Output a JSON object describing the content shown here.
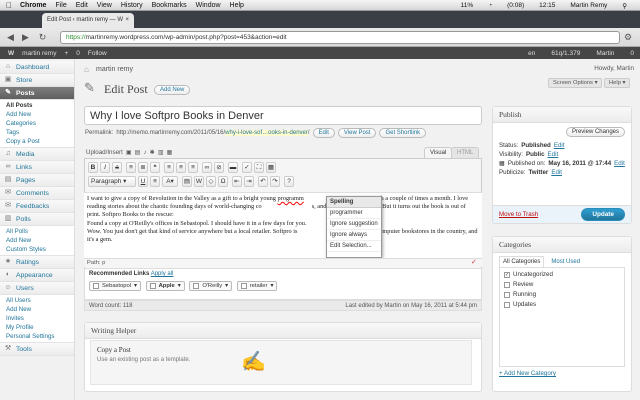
{
  "mac_menu": {
    "apple": "",
    "app": "Chrome",
    "items": [
      "File",
      "Edit",
      "View",
      "History",
      "Bookmarks",
      "Window",
      "Help"
    ],
    "battery": "11%",
    "time_a": "(0:08)",
    "time_b": "12:15",
    "user": "Martin Remy"
  },
  "browser": {
    "tab_title": "Edit Post ‹ martin remy — W",
    "tab_close": "×",
    "url_scheme": "https://",
    "url_rest": "martinremy.wordpress.com/wp-admin/post.php?post=453&action=edit",
    "back": "◀",
    "forward": "▶",
    "reload": "↻"
  },
  "wpbar": {
    "logo": "W",
    "site": "martin remy",
    "new": "+",
    "comments": "0",
    "follow": "Follow",
    "lang": "en",
    "stats": "61q/1.379",
    "user": "Martin",
    "notif": "0"
  },
  "sidebar": {
    "items": [
      {
        "label": "Dashboard",
        "icon": "⌂"
      },
      {
        "label": "Store",
        "icon": "▣"
      },
      {
        "label": "Posts",
        "icon": "✎"
      }
    ],
    "posts_sub": [
      "All Posts",
      "Add New",
      "Categories",
      "Tags",
      "Copy a Post"
    ],
    "items2": [
      {
        "label": "Media",
        "icon": "♫"
      },
      {
        "label": "Links",
        "icon": "∞"
      },
      {
        "label": "Pages",
        "icon": "▤"
      },
      {
        "label": "Comments",
        "icon": "✉"
      },
      {
        "label": "Feedbacks",
        "icon": "✉"
      },
      {
        "label": "Polls",
        "icon": "▥"
      }
    ],
    "polls_sub": [
      "All Polls",
      "Add New",
      "Custom Styles"
    ],
    "items3": [
      {
        "label": "Ratings",
        "icon": "★"
      },
      {
        "label": "Appearance",
        "icon": "◐"
      },
      {
        "label": "Users",
        "icon": "☺"
      }
    ],
    "users_sub": [
      "All Users",
      "Add New",
      "Invites",
      "My Profile",
      "Personal Settings"
    ],
    "items4": [
      {
        "label": "Tools",
        "icon": "⚒"
      }
    ]
  },
  "header": {
    "site_name": "martin remy",
    "howdy": "Howdy, Martin",
    "screen_options": "Screen Options ▾",
    "help": "Help ▾",
    "page_title": "Edit Post",
    "add_new": "Add New"
  },
  "post": {
    "title": "Why I love Softpro Books in Denver",
    "permalink_label": "Permalink:",
    "permalink_base": "http://memo.martinremy.com/2011/05/16/",
    "permalink_slug": "why-i-love-sof…ooks-in-denver",
    "permalink_end": "/",
    "edit_btn": "Edit",
    "view_btn": "View Post",
    "shortlink_btn": "Get Shortlink",
    "upload_insert": "Upload/Insert",
    "tab_visual": "Visual",
    "tab_html": "HTML",
    "paragraph_select": "Paragraph",
    "body_1": "I want to give a copy of Revolution in the Valley as a gift to a bright young ",
    "body_misspelled": "programm",
    "body_1b": "I met with a couple of times a month.  I love reading stories about the chaotic founding days of world-changing co",
    "body_1c": "s, and I think he would too.  But it turns out the book is out of print.  Softpro Books to the rescue:",
    "body_2": "Found a copy at O'Reilly's offices in Sebastopol. I should have it in a few days for you.",
    "body_3": "Wow.  You just don't get that kind of service anywhere but a local retailer.  Softpro is",
    "body_3b": "ining retail computer bookstores in the country, and it's a gem.",
    "path": "Path: p",
    "rec_title": "Recommended Links",
    "apply_all": "Apply all",
    "rec_tags": [
      "Sebastopol",
      "Apple",
      "O'Reilly",
      "retailer"
    ],
    "word_count": "Word count: 118",
    "last_edited": "Last edited by Martin on May 16, 2011 at 5:44 pm"
  },
  "spell_menu": {
    "title": "Spelling",
    "items": [
      "programmer",
      "Ignore suggestion",
      "Ignore always",
      "Edit Selection..."
    ]
  },
  "writing_helper": {
    "title": "Writing Helper",
    "copy_title": "Copy a Post",
    "copy_desc": "Use an existing post as a template."
  },
  "publish": {
    "title": "Publish",
    "preview": "Preview Changes",
    "status_label": "Status:",
    "status_value": "Published",
    "visibility_label": "Visibility:",
    "visibility_value": "Public",
    "published_label": "Published on:",
    "published_value": "May 16, 2011 @ 17:44",
    "publicize_label": "Publicize:",
    "publicize_value": "Twitter",
    "edit": "Edit",
    "trash": "Move to Trash",
    "update": "Update"
  },
  "categories": {
    "title": "Categories",
    "tab_all": "All Categories",
    "tab_most": "Most Used",
    "items": [
      {
        "label": "Uncategorized",
        "checked": true
      },
      {
        "label": "Review",
        "checked": false
      },
      {
        "label": "Running",
        "checked": false
      },
      {
        "label": "Updates",
        "checked": false
      }
    ],
    "add_new": "+ Add New Category"
  },
  "colors": {
    "link": "#21759b",
    "current_menu": "#6d6d6d",
    "update_btn": "#21759b",
    "trash": "#bc0b0b"
  }
}
